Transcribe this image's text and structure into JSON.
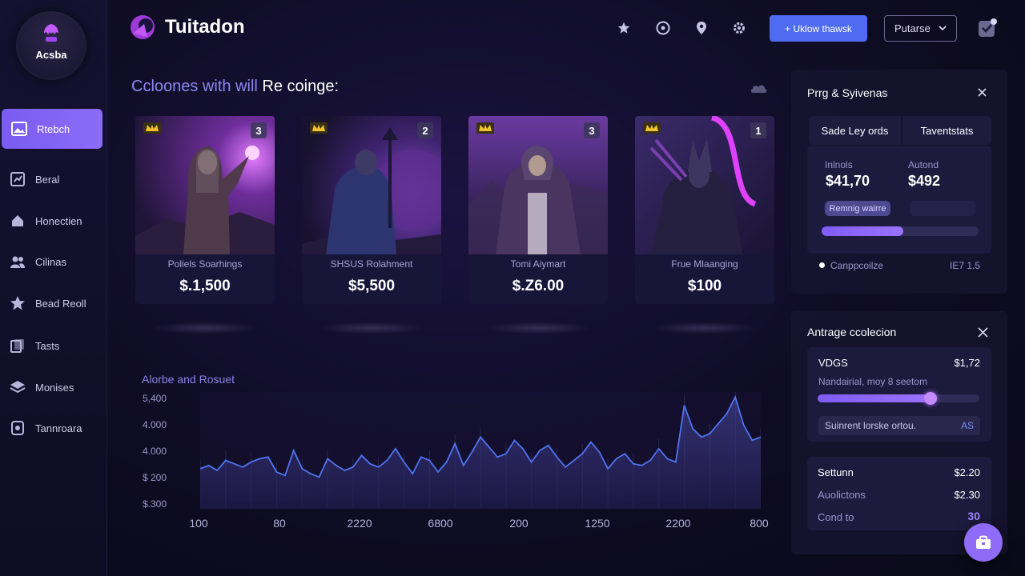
{
  "logo": {
    "name": "Acsba"
  },
  "brand": {
    "title": "Tuitadon"
  },
  "header": {
    "primary_button": "+ Uklow thawsk",
    "select_value": "Putarse",
    "icons": [
      "star-icon",
      "target-icon",
      "location-pin-icon",
      "gear-icon",
      "notification-icon"
    ]
  },
  "sidebar": {
    "items": [
      {
        "label": "Rtebch",
        "icon": "image-icon",
        "active": true
      },
      {
        "label": "Beral",
        "icon": "dashboard-icon"
      },
      {
        "label": "Honectien",
        "icon": "home-icon"
      },
      {
        "label": "Cilinas",
        "icon": "users-icon"
      },
      {
        "label": "Bead Reoll",
        "icon": "star-icon"
      },
      {
        "label": "Tasts",
        "icon": "copy-icon"
      },
      {
        "label": "Monises",
        "icon": "layers-icon"
      },
      {
        "label": "Tannroara",
        "icon": "box-icon"
      }
    ]
  },
  "section": {
    "title_a": "Ccloones with will",
    "title_b": "Re coinge:"
  },
  "cards": [
    {
      "name": "Poliels Soarhings",
      "price": "$.1,500",
      "count": "3"
    },
    {
      "name": "SHSUS Rolahment",
      "price": "$5,500",
      "count": "2"
    },
    {
      "name": "Tomi Aiymart",
      "price": "$.Z6.00",
      "count": "3"
    },
    {
      "name": "Frue Mlaanging",
      "price": "$100",
      "count": "1"
    }
  ],
  "chart_data": {
    "type": "area",
    "title": "Alorbe and Rosuet",
    "y_ticks": [
      "5,400",
      "4.000",
      "4.000",
      "$ 200",
      "$.300"
    ],
    "x_ticks": [
      "100",
      "80",
      "2220",
      "6800",
      "200",
      "1250",
      "2200",
      "800"
    ],
    "series": [
      {
        "values": [
          48,
          52,
          46,
          58,
          54,
          50,
          56,
          60,
          62,
          44,
          40,
          70,
          48,
          42,
          38,
          60,
          52,
          46,
          50,
          64,
          54,
          50,
          58,
          72,
          56,
          42,
          62,
          58,
          44,
          56,
          78,
          52,
          68,
          86,
          74,
          62,
          66,
          82,
          72,
          56,
          70,
          76,
          62,
          50,
          58,
          66,
          80,
          68,
          48,
          60,
          66,
          54,
          52,
          58,
          72,
          60,
          56,
          124,
          96,
          86,
          90,
          102,
          114,
          134,
          100,
          82,
          86
        ]
      }
    ],
    "grid": false,
    "color": "#4f74f0"
  },
  "panel1": {
    "title": "Prrg & Syivenas",
    "tabs": [
      "Sade Ley ords",
      "Taventstats"
    ],
    "stat1_label": "Inlnols",
    "stat1_value": "$41,70",
    "stat2_label": "Autond",
    "stat2_value": "$492",
    "pill": "Remnig wairre",
    "progress": 0.52,
    "legend_label": "Canppcoilze",
    "legend_value": "IE7 1.5"
  },
  "panel2": {
    "title": "Antrage ccolecion",
    "row1_name": "VDGS",
    "row1_value": "$1,72",
    "row1_sub": "Nandairial, moy 8 seetom",
    "slider": 0.7,
    "input_text": "Suinrent lorske ortou.",
    "input_badge": "AS",
    "rows": [
      {
        "label": "Settunn",
        "value": "$2.20"
      },
      {
        "label": "Auolictons",
        "value": "$2.30"
      },
      {
        "label": "Cond to",
        "value": "30"
      }
    ]
  }
}
